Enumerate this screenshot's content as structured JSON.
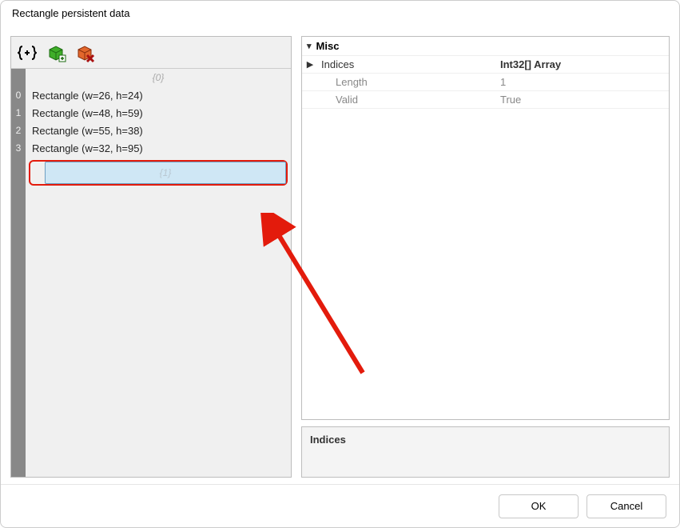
{
  "window": {
    "title": "Rectangle persistent data"
  },
  "toolbar": {
    "icons": [
      "braces-plus-icon",
      "cube-add-icon",
      "cube-remove-icon"
    ]
  },
  "tree": {
    "groups": [
      {
        "label": "{0}",
        "selected": false,
        "items": [
          {
            "index": "0",
            "label": "Rectangle (w=26, h=24)"
          },
          {
            "index": "1",
            "label": "Rectangle (w=48, h=59)"
          },
          {
            "index": "2",
            "label": "Rectangle (w=55, h=38)"
          },
          {
            "index": "3",
            "label": "Rectangle (w=32, h=95)"
          }
        ]
      },
      {
        "label": "{1}",
        "selected": true,
        "items": []
      }
    ]
  },
  "properties": {
    "category": "Misc",
    "rows": [
      {
        "expander": "▶",
        "name": "Indices",
        "value": "Int32[] Array",
        "bold": true,
        "indent": false
      },
      {
        "expander": "",
        "name": "Length",
        "value": "1",
        "bold": false,
        "indent": true
      },
      {
        "expander": "",
        "name": "Valid",
        "value": "True",
        "bold": false,
        "indent": true
      }
    ]
  },
  "description": {
    "title": "Indices"
  },
  "buttons": {
    "ok": "OK",
    "cancel": "Cancel"
  },
  "annotation": {
    "type": "arrow",
    "color": "#e31b0c"
  }
}
